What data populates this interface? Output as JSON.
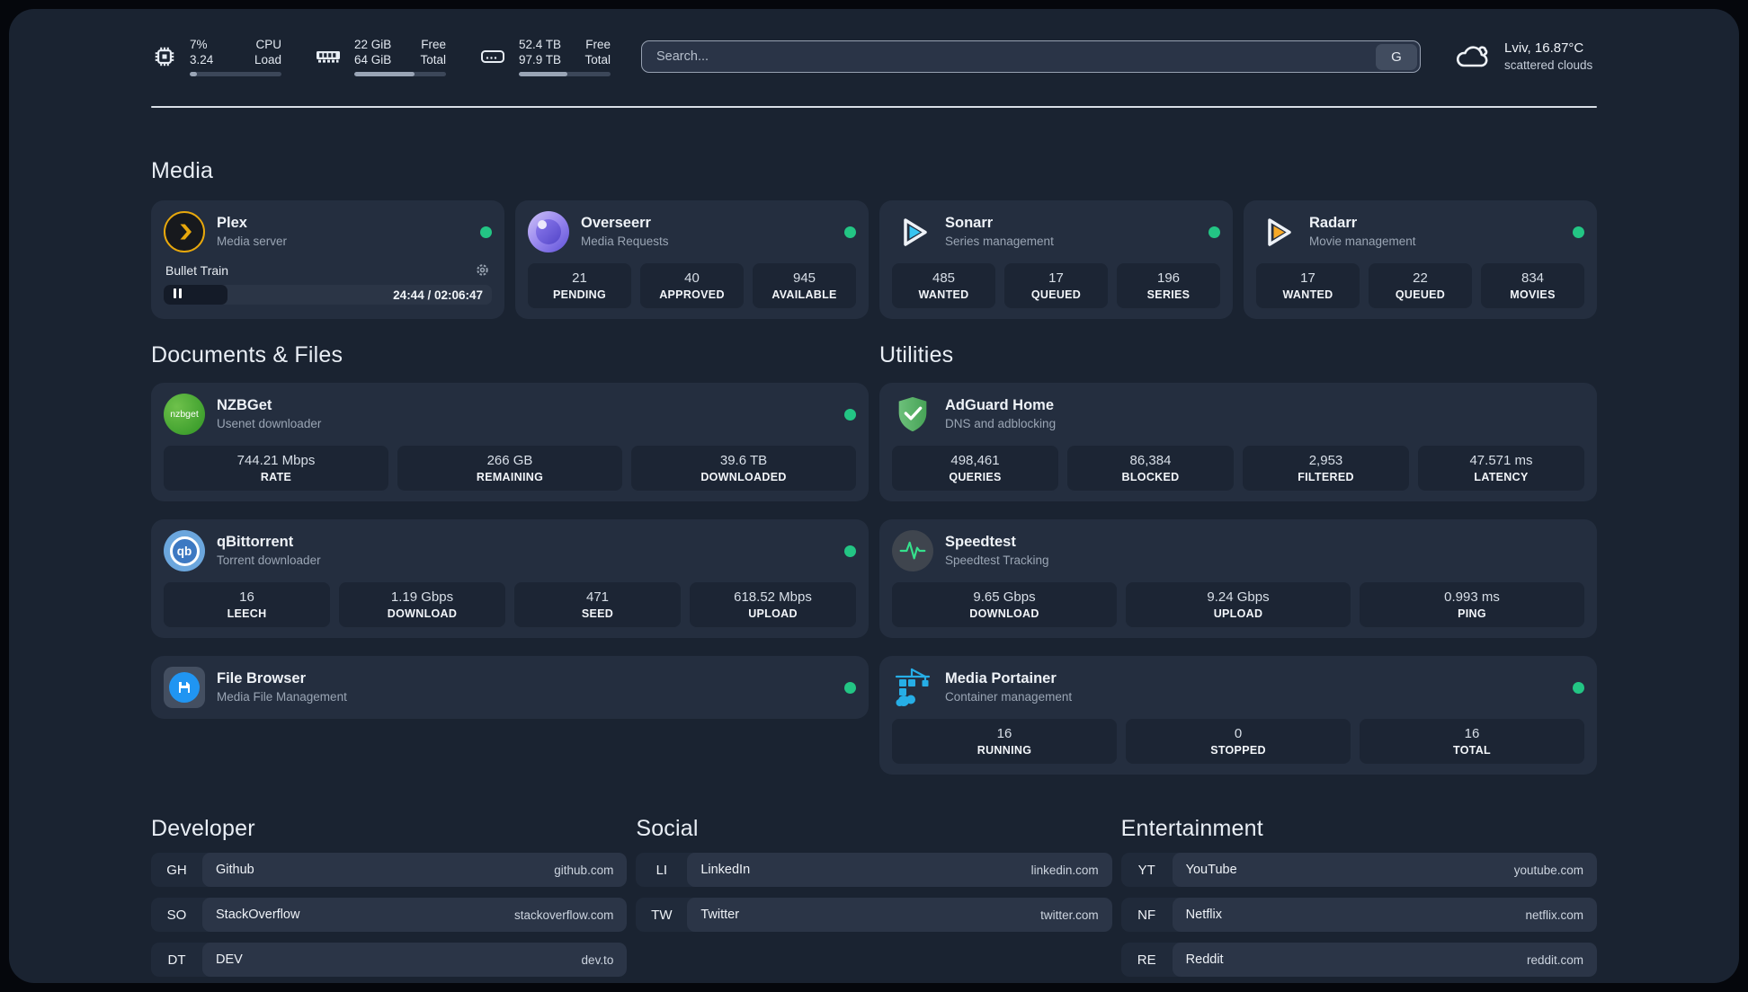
{
  "colors": {
    "status_online": "#23c584",
    "accent_plex": "#e8a80c",
    "accent_sonarr": "#38c5f1",
    "accent_radarr": "#f7a927",
    "accent_portainer": "#26aee6",
    "accent_adguard": "#57b263",
    "accent_speedtest_pulse": "#35e08c"
  },
  "header": {
    "stats": [
      {
        "icon": "cpu-icon",
        "value_top": "7%",
        "label_top": "CPU",
        "value_bottom": "3.24",
        "label_bottom": "Load",
        "progress": 8
      },
      {
        "icon": "memory-icon",
        "value_top": "22 GiB",
        "label_top": "Free",
        "value_bottom": "64 GiB",
        "label_bottom": "Total",
        "progress": 66
      },
      {
        "icon": "disk-icon",
        "value_top": "52.4 TB",
        "label_top": "Free",
        "value_bottom": "97.9 TB",
        "label_bottom": "Total",
        "progress": 53
      }
    ],
    "search": {
      "placeholder": "Search...",
      "button": "G"
    },
    "weather": {
      "title": "Lviv, 16.87°C",
      "subtitle": "scattered clouds"
    }
  },
  "media": {
    "title": "Media",
    "plex": {
      "name": "Plex",
      "desc": "Media server",
      "player": {
        "title": "Bullet Train",
        "time": "24:44 / 02:06:47",
        "progress": 19.5
      }
    },
    "overseerr": {
      "name": "Overseerr",
      "desc": "Media Requests",
      "stats": [
        {
          "value": "21",
          "label": "PENDING"
        },
        {
          "value": "40",
          "label": "APPROVED"
        },
        {
          "value": "945",
          "label": "AVAILABLE"
        }
      ]
    },
    "sonarr": {
      "name": "Sonarr",
      "desc": "Series management",
      "stats": [
        {
          "value": "485",
          "label": "WANTED"
        },
        {
          "value": "17",
          "label": "QUEUED"
        },
        {
          "value": "196",
          "label": "SERIES"
        }
      ]
    },
    "radarr": {
      "name": "Radarr",
      "desc": "Movie management",
      "stats": [
        {
          "value": "17",
          "label": "WANTED"
        },
        {
          "value": "22",
          "label": "QUEUED"
        },
        {
          "value": "834",
          "label": "MOVIES"
        }
      ]
    }
  },
  "documents": {
    "title": "Documents & Files",
    "nzbget": {
      "name": "NZBGet",
      "desc": "Usenet downloader",
      "icon_text": "nzbget",
      "stats": [
        {
          "value": "744.21 Mbps",
          "label": "RATE"
        },
        {
          "value": "266 GB",
          "label": "REMAINING"
        },
        {
          "value": "39.6 TB",
          "label": "DOWNLOADED"
        }
      ]
    },
    "qbittorrent": {
      "name": "qBittorrent",
      "desc": "Torrent downloader",
      "icon_text": "qb",
      "stats": [
        {
          "value": "16",
          "label": "LEECH"
        },
        {
          "value": "1.19 Gbps",
          "label": "DOWNLOAD"
        },
        {
          "value": "471",
          "label": "SEED"
        },
        {
          "value": "618.52 Mbps",
          "label": "UPLOAD"
        }
      ]
    },
    "filebrowser": {
      "name": "File Browser",
      "desc": "Media File Management"
    }
  },
  "utilities": {
    "title": "Utilities",
    "adguard": {
      "name": "AdGuard Home",
      "desc": "DNS and adblocking",
      "stats": [
        {
          "value": "498,461",
          "label": "QUERIES"
        },
        {
          "value": "86,384",
          "label": "BLOCKED"
        },
        {
          "value": "2,953",
          "label": "FILTERED"
        },
        {
          "value": "47.571 ms",
          "label": "LATENCY"
        }
      ]
    },
    "speedtest": {
      "name": "Speedtest",
      "desc": "Speedtest Tracking",
      "stats": [
        {
          "value": "9.65 Gbps",
          "label": "DOWNLOAD"
        },
        {
          "value": "9.24 Gbps",
          "label": "UPLOAD"
        },
        {
          "value": "0.993 ms",
          "label": "PING"
        }
      ]
    },
    "portainer": {
      "name": "Media Portainer",
      "desc": "Container management",
      "stats": [
        {
          "value": "16",
          "label": "RUNNING"
        },
        {
          "value": "0",
          "label": "STOPPED"
        },
        {
          "value": "16",
          "label": "TOTAL"
        }
      ]
    }
  },
  "bookmarks": {
    "developer": {
      "title": "Developer",
      "items": [
        {
          "abbr": "GH",
          "name": "Github",
          "url": "github.com"
        },
        {
          "abbr": "SO",
          "name": "StackOverflow",
          "url": "stackoverflow.com"
        },
        {
          "abbr": "DT",
          "name": "DEV",
          "url": "dev.to"
        }
      ]
    },
    "social": {
      "title": "Social",
      "items": [
        {
          "abbr": "LI",
          "name": "LinkedIn",
          "url": "linkedin.com"
        },
        {
          "abbr": "TW",
          "name": "Twitter",
          "url": "twitter.com"
        }
      ]
    },
    "entertainment": {
      "title": "Entertainment",
      "items": [
        {
          "abbr": "YT",
          "name": "YouTube",
          "url": "youtube.com"
        },
        {
          "abbr": "NF",
          "name": "Netflix",
          "url": "netflix.com"
        },
        {
          "abbr": "RE",
          "name": "Reddit",
          "url": "reddit.com"
        }
      ]
    }
  }
}
